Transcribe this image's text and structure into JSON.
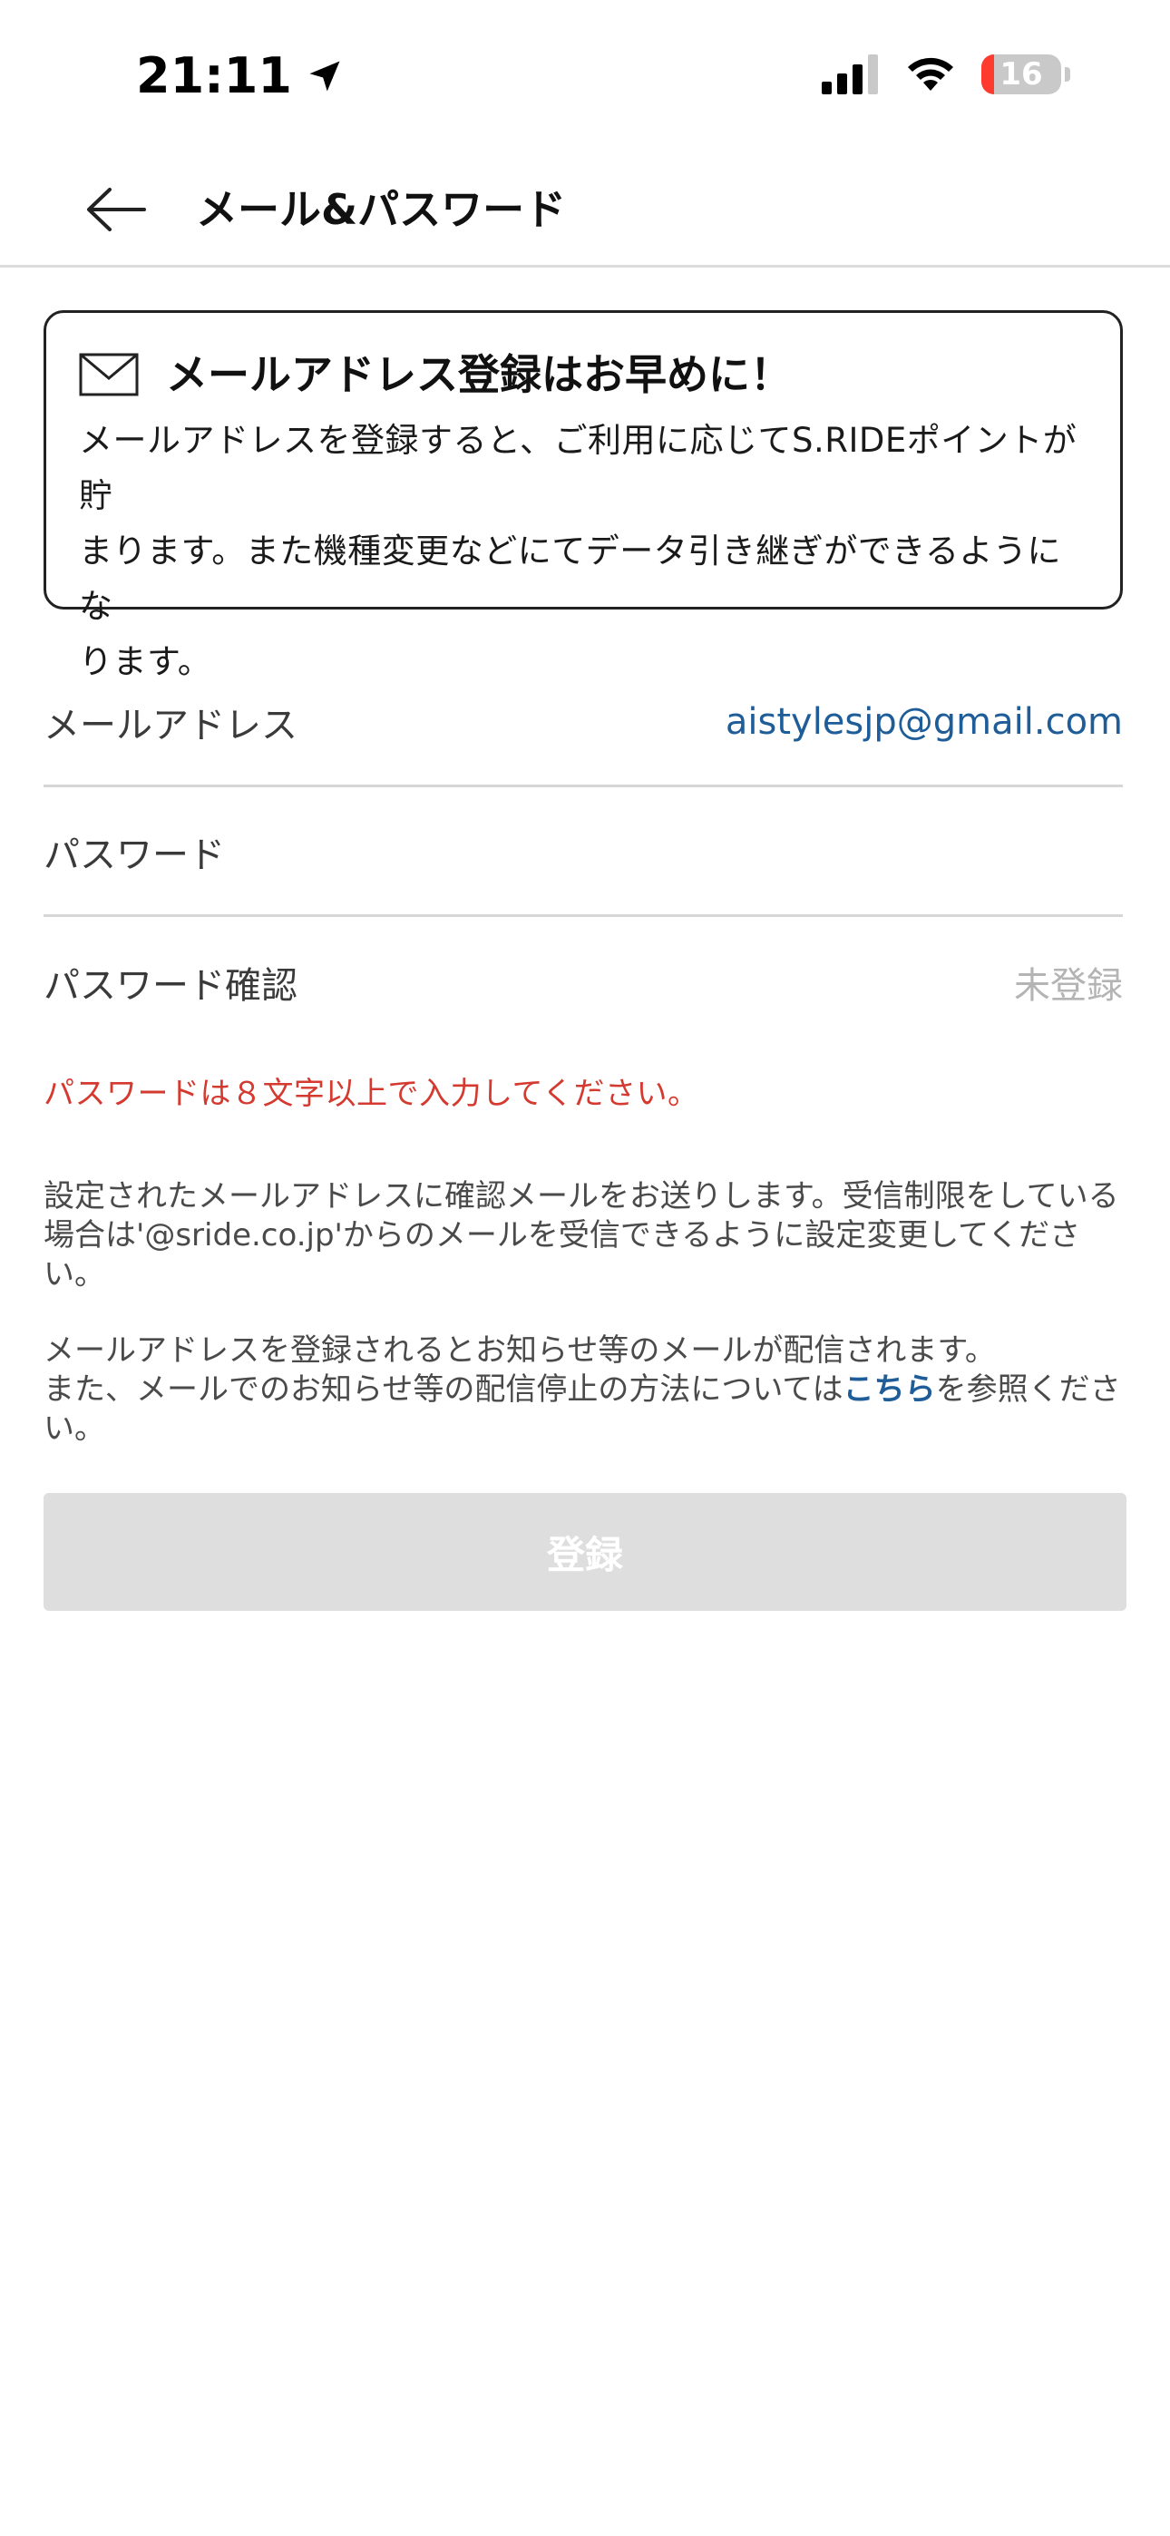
{
  "status_bar": {
    "time": "21:11",
    "battery_level": "16",
    "icons": [
      "location-arrow-icon",
      "cellular-signal-icon",
      "wifi-icon",
      "battery-icon"
    ]
  },
  "header": {
    "title": "メール&パスワード",
    "back_icon": "arrow-left-icon"
  },
  "notice": {
    "icon": "mail-icon",
    "title": "メールアドレス登録はお早めに！",
    "body_lines": [
      "メールアドレスを登録すると、ご利用に応じてS.RIDEポイントが貯",
      "まります。また機種変更などにてデータ引き継ぎができるようにな",
      "ります。"
    ]
  },
  "form": {
    "email": {
      "label": "メールアドレス",
      "value": "aistylesjp@gmail.com"
    },
    "password": {
      "label": "パスワード",
      "value": ""
    },
    "password_confirm": {
      "label": "パスワード確認",
      "value": "未登録"
    }
  },
  "error_message": "パスワードは８文字以上で入力してください。",
  "info": {
    "para1_lines": [
      "設定されたメールアドレスに確認メールをお送りします。受信制限をしている",
      "場合は'@sride.co.jp'からのメールを受信できるように設定変更してくださ",
      "い。"
    ],
    "para2_line1": "メールアドレスを登録されるとお知らせ等のメールが配信されます。",
    "para2_line2_prefix": "また、メールでのお知らせ等の配信停止の方法については",
    "para2_link": "こちら",
    "para2_line2_suffix": "を参照くださ",
    "para2_line3": "い。"
  },
  "register_button": {
    "label": "登録"
  },
  "colors": {
    "link": "#1f5d99",
    "error": "#d43a2f",
    "disabled_button": "#dedede",
    "muted": "#b4b4b4"
  }
}
